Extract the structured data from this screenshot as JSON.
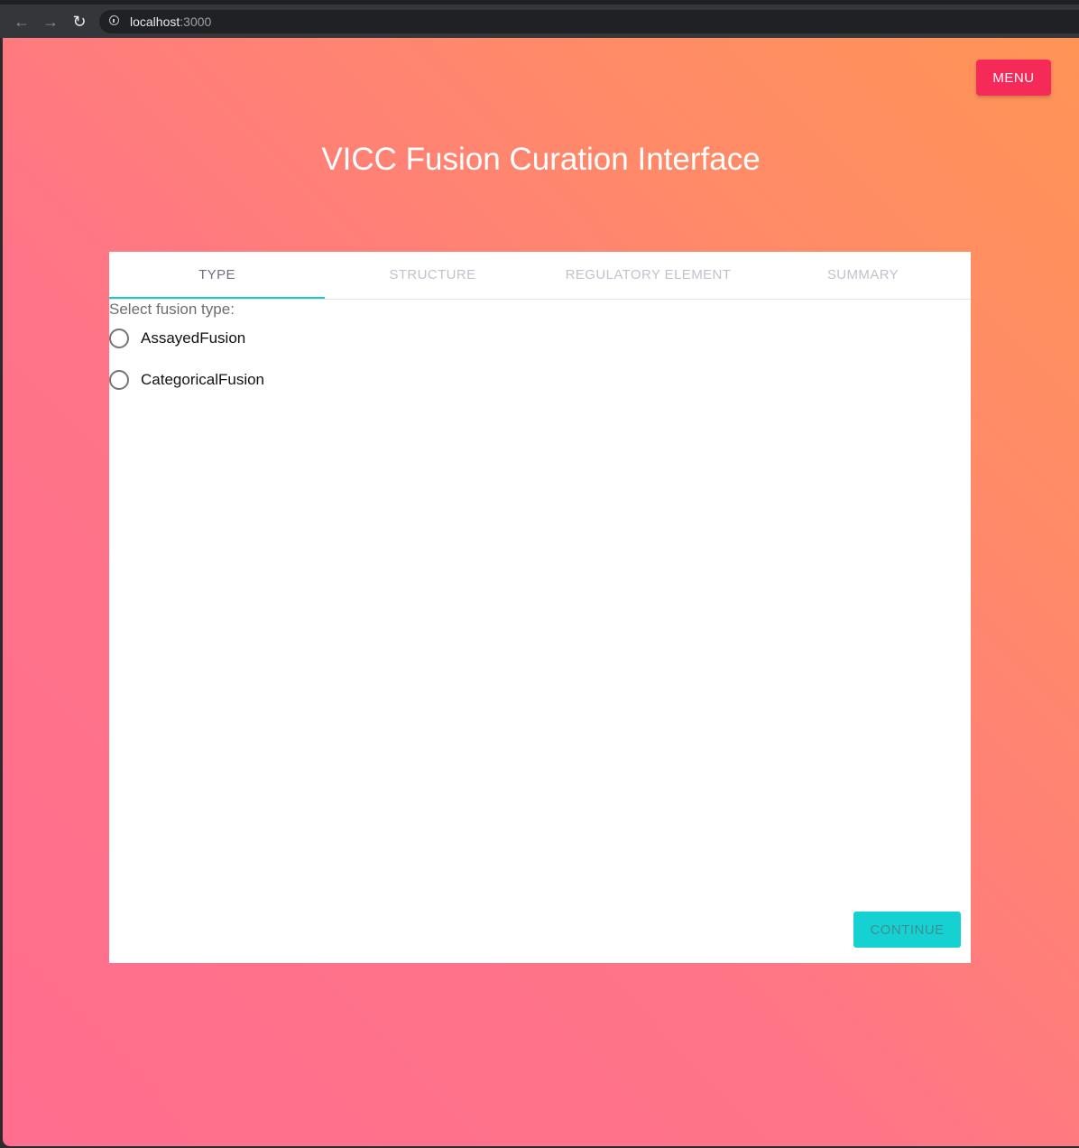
{
  "browser": {
    "back_icon": "arrow-left-icon",
    "forward_icon": "arrow-right-icon",
    "reload_icon": "reload-icon",
    "url_host": "localhost",
    "url_port": ":3000"
  },
  "header": {
    "menu_label": "MENU",
    "title": "VICC Fusion Curation Interface"
  },
  "tabs": [
    {
      "label": "TYPE",
      "active": true
    },
    {
      "label": "STRUCTURE",
      "active": false
    },
    {
      "label": "REGULATORY ELEMENT",
      "active": false
    },
    {
      "label": "SUMMARY",
      "active": false
    }
  ],
  "type_step": {
    "prompt": "Select fusion type:",
    "options": [
      {
        "label": "AssayedFusion",
        "selected": false
      },
      {
        "label": "CategoricalFusion",
        "selected": false
      }
    ]
  },
  "footer": {
    "continue_label": "CONTINUE"
  },
  "colors": {
    "menu_button": "#f52a59",
    "accent": "#1fc7d0",
    "continue_button": "#16d1d1",
    "gradient_start": "#ff6e8e",
    "gradient_end": "#ff9456"
  }
}
